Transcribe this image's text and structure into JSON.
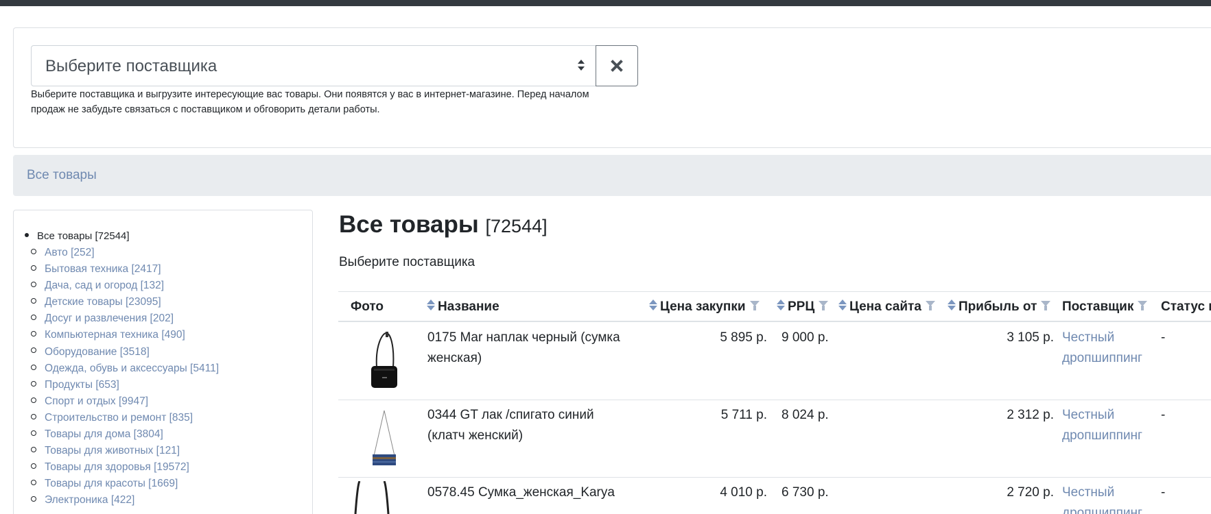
{
  "supplier_select": {
    "placeholder": "Выберите поставщика",
    "help_text_line1": "Выберите поставщика и выгрузите интересующие вас товары. Они появятся у вас в интернет-магазине. Перед началом",
    "help_text_line2": "продаж не забудьте связаться с поставщиком и обговорить детали работы."
  },
  "breadcrumb": {
    "label": "Все товары"
  },
  "sidebar": {
    "root_label": "Все товары [72544]",
    "categories": [
      "Авто [252]",
      "Бытовая техника [2417]",
      "Дача, сад и огород [132]",
      "Детские товары [23095]",
      "Досуг и развлечения [202]",
      "Компьютерная техника [490]",
      "Оборудование [3518]",
      "Одежда, обувь и аксессуары [5411]",
      "Продукты [653]",
      "Спорт и отдых [9947]",
      "Строительство и ремонт [835]",
      "Товары для дома [3804]",
      "Товары для животных [121]",
      "Товары для здоровья [19572]",
      "Товары для красоты [1669]",
      "Электроника [422]"
    ]
  },
  "main": {
    "title": "Все товары",
    "title_count": "[72544]",
    "subtitle": "Выберите поставщика"
  },
  "table": {
    "headers": {
      "photo": "Фото",
      "name": "Название",
      "purchase_price": "Цена закупки",
      "rrp": "РРЦ",
      "site_price": "Цена сайта",
      "profit": "Прибыль от",
      "supplier": "Поставщик",
      "status": "Статус в"
    },
    "rows": [
      {
        "name_line1": "0175 Mar наплак черный (сумка",
        "name_line2": "женская)",
        "purchase_price": "5 895 р.",
        "rrp": "9 000 р.",
        "site_price": "",
        "profit": "3 105 р.",
        "supplier_line1": "Честный",
        "supplier_line2": "дропшиппинг",
        "status": "-"
      },
      {
        "name_line1": "0344 GT лак /спигато синий",
        "name_line2": "(клатч женский)",
        "purchase_price": "5 711 р.",
        "rrp": "8 024 р.",
        "site_price": "",
        "profit": "2 312 р.",
        "supplier_line1": "Честный",
        "supplier_line2": "дропшиппинг",
        "status": "-"
      },
      {
        "name_line1": "0578.45 Сумка_женская_Karya",
        "name_line2": "",
        "purchase_price": "4 010 р.",
        "rrp": "6 730 р.",
        "site_price": "",
        "profit": "2 720 р.",
        "supplier_line1": "Честный",
        "supplier_line2": "дропшиппинг",
        "status": "-"
      }
    ]
  },
  "colors": {
    "link": "#6f89b0",
    "topbar": "#343a40",
    "breadcrumb_bg": "#e9ecef"
  }
}
